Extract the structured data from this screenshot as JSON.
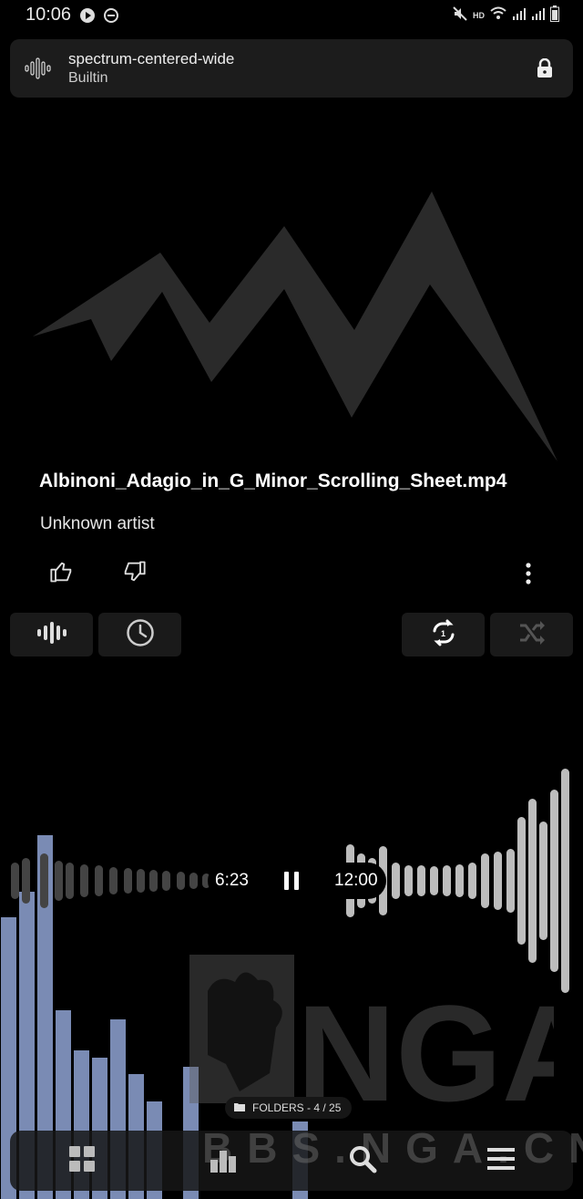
{
  "status_bar": {
    "time": "10:06",
    "indicator": "HD"
  },
  "preset": {
    "name": "spectrum-centered-wide",
    "source": "Builtin",
    "icon": "waveform-icon",
    "lock_icon": "lock-icon"
  },
  "track": {
    "title": "Albinoni_Adagio_in_G_Minor_Scrolling_Sheet.mp4",
    "artist": "Unknown artist"
  },
  "actions": {
    "like_icon": "thumbs-up-icon",
    "dislike_icon": "thumbs-down-icon",
    "more_icon": "more-vertical-icon"
  },
  "controls": {
    "visualizer_icon": "waveform-icon",
    "sleep_timer_icon": "clock-icon",
    "repeat_icon": "repeat-one-icon",
    "shuffle_icon": "shuffle-icon"
  },
  "playback": {
    "elapsed": "6:23",
    "total": "12:00",
    "state_icon": "pause-icon"
  },
  "queue": {
    "label": "FOLDERS - 4 / 25"
  },
  "bottom_nav": {
    "items": [
      {
        "icon": "grid-icon"
      },
      {
        "icon": "bar-chart-icon"
      },
      {
        "icon": "search-icon"
      },
      {
        "icon": "menu-icon"
      }
    ]
  },
  "watermark": {
    "logo_text": "NGA",
    "text": "BBS.NGA.CN"
  },
  "colors": {
    "background": "#000000",
    "panel": "#1c1c1c",
    "spectrum_bars": "#8fa3d4",
    "wave_bars": "#bdbdbd"
  }
}
